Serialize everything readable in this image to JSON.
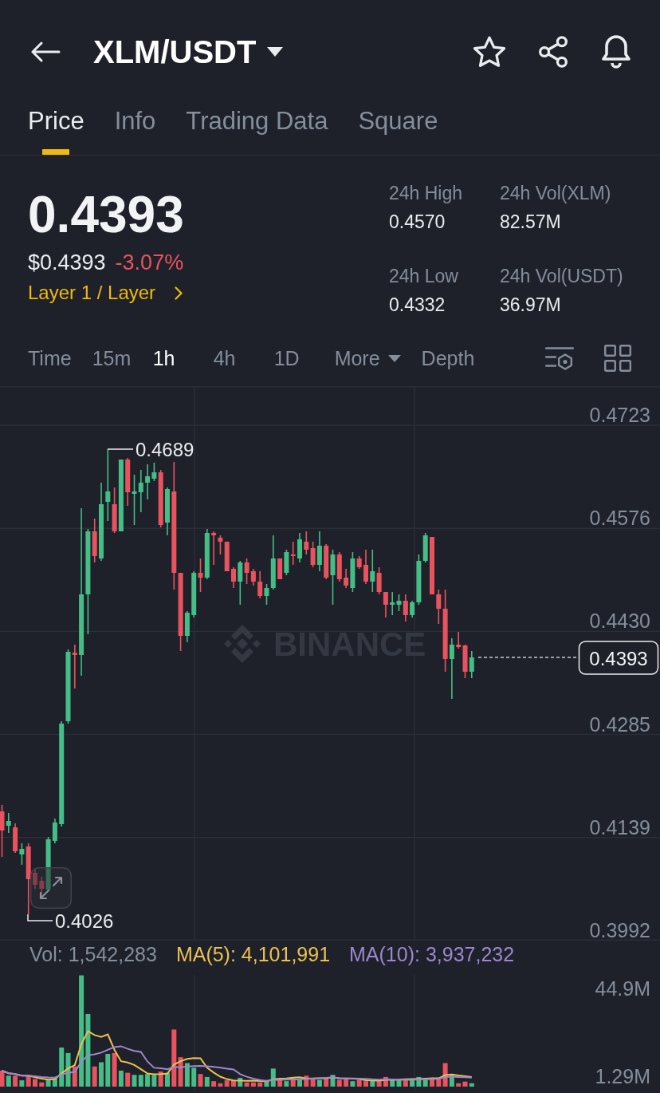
{
  "header": {
    "title": "XLM/USDT"
  },
  "tabs": [
    {
      "label": "Price",
      "selected": true
    },
    {
      "label": "Info",
      "selected": false
    },
    {
      "label": "Trading Data",
      "selected": false
    },
    {
      "label": "Square",
      "selected": false
    }
  ],
  "ticker": {
    "last_price": "0.4393",
    "usd_price": "$0.4393",
    "change": "-3.07%",
    "category": "Layer 1 / Layer"
  },
  "stats": [
    {
      "label": "24h High",
      "value": "0.4570"
    },
    {
      "label": "24h Vol(XLM)",
      "value": "82.57M"
    },
    {
      "label": "24h Low",
      "value": "0.4332"
    },
    {
      "label": "24h Vol(USDT)",
      "value": "36.97M"
    }
  ],
  "chart_options": [
    {
      "label": "Time",
      "kind": "option",
      "selected": false
    },
    {
      "label": "15m",
      "kind": "option",
      "selected": false
    },
    {
      "label": "1h",
      "kind": "option",
      "selected": true
    },
    {
      "label": "4h",
      "kind": "option",
      "selected": false
    },
    {
      "label": "1D",
      "kind": "option",
      "selected": false
    },
    {
      "label": "More",
      "kind": "dropdown",
      "selected": false
    },
    {
      "label": "Depth",
      "kind": "option",
      "selected": false
    }
  ],
  "price_chart": {
    "axis_labels": [
      "0.4723",
      "0.4576",
      "0.4430",
      "0.4285",
      "0.4139",
      "0.3992"
    ],
    "high_label": "0.4689",
    "low_label": "0.4026",
    "last_price_tag": "0.4393",
    "watermark": "BINANCE"
  },
  "volume": {
    "legend": [
      {
        "text": "Vol: 1,542,283",
        "color": "#848e9c"
      },
      {
        "text": "MA(5): 4,101,991",
        "color": "#ebc24f"
      },
      {
        "text": "MA(10): 3,937,232",
        "color": "#9d87cf"
      }
    ],
    "axis_labels": [
      "44.9M",
      "1.29M"
    ]
  }
}
